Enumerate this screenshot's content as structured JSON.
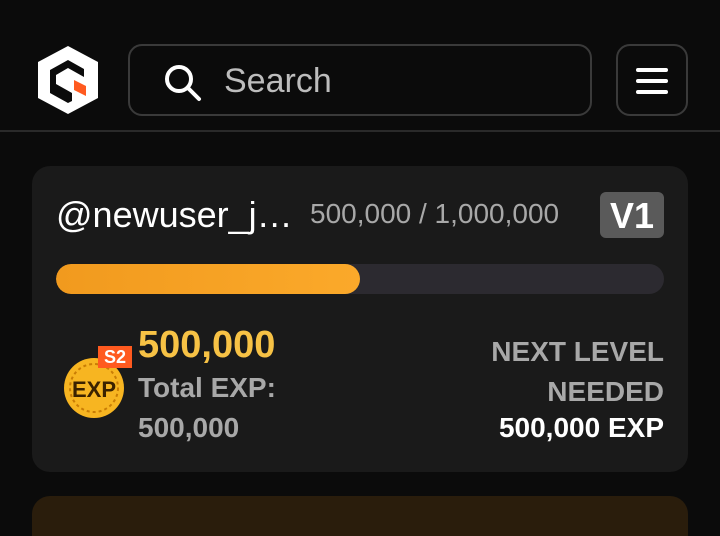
{
  "header": {
    "search": {
      "placeholder": "Search"
    },
    "icons": {
      "logo": "brand-logo",
      "search": "search-icon",
      "menu": "hamburger-menu-icon"
    }
  },
  "profile_card": {
    "username": "@newuser_j…",
    "progress_text": "500,000 / 1,000,000",
    "progress_fraction": 0.5,
    "level_badge": "V1",
    "exp_badge": {
      "season": "S2",
      "label": "EXP"
    },
    "exp_value": "500,000",
    "total_exp_label": "Total EXP:",
    "total_exp_value": "500,000",
    "next_level_label_line1": "NEXT LEVEL",
    "next_level_label_line2": "NEEDED",
    "next_level_needed": "500,000 EXP"
  },
  "colors": {
    "background": "#0b0b0b",
    "card": "#1a1a1a",
    "accent_orange": "#f19a1e",
    "exp_yellow": "#f7c245",
    "muted_text": "#a8a8a8"
  }
}
